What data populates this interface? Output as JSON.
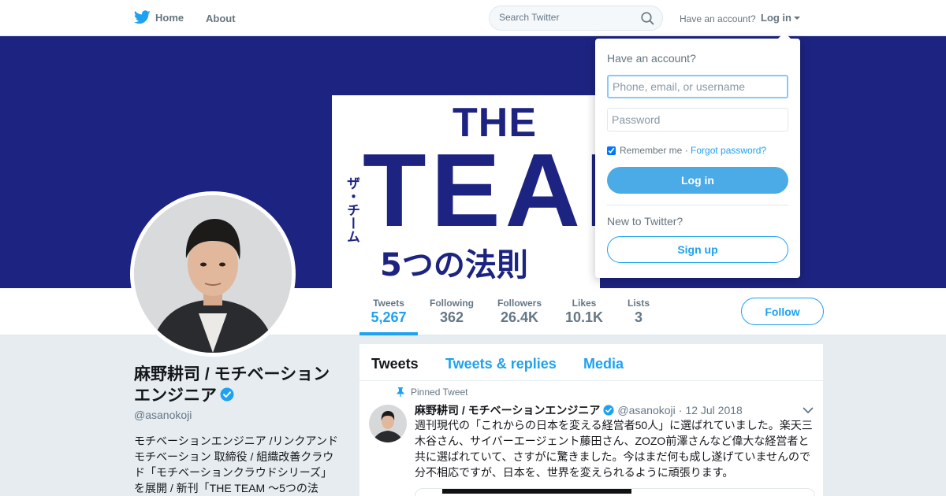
{
  "nav": {
    "home_label": "Home",
    "about_label": "About",
    "search_placeholder": "Search Twitter",
    "have_account": "Have an account?",
    "login_label": "Log in"
  },
  "banner": {
    "background_color": "#1d2381",
    "line_the": "THE",
    "line_team": "TEAM",
    "line_katakana": "ザ・チーム",
    "line_subtitle": "5つの法則"
  },
  "profile_stats": [
    {
      "label": "Tweets",
      "value": "5,267",
      "active": true
    },
    {
      "label": "Following",
      "value": "362"
    },
    {
      "label": "Followers",
      "value": "26.4K"
    },
    {
      "label": "Likes",
      "value": "10.1K"
    },
    {
      "label": "Lists",
      "value": "3"
    }
  ],
  "follow_label": "Follow",
  "profile": {
    "name_line1": "麻野耕司 / モチベーション",
    "name_line2": "エンジニア",
    "verified": true,
    "handle": "@asanokoji",
    "bio": "モチベーションエンジニア /リンクアンドモチベーション 取締役 / 組織改善クラウド「モチベーションクラウドシリーズ」を展開 / 新刊「THE TEAM 〜5つの法"
  },
  "timeline": {
    "tabs": [
      "Tweets",
      "Tweets & replies",
      "Media"
    ],
    "active_tab": "Tweets",
    "pinned_label": "Pinned Tweet",
    "tweet": {
      "name": "麻野耕司 / モチベーションエンジニア",
      "handle": "@asanokoji",
      "separator": "·",
      "date": "12 Jul 2018",
      "text": "週刊現代の「これからの日本を変える経営者50人」に選ばれていました。楽天三木谷さん、サイバーエージェント藤田さん、ZOZO前澤さんなど偉大な経営者と共に選ばれていて、さすがに驚きました。今はまだ何も成し遂げていませんので分不相応ですが、日本を、世界を変えられるように頑張ります。"
    }
  },
  "login_dropdown": {
    "title": "Have an account?",
    "username_placeholder": "Phone, email, or username",
    "password_placeholder": "Password",
    "remember_label": "Remember me",
    "remember_checked": true,
    "separator": " · ",
    "forgot_label": "Forgot password?",
    "login_button": "Log in",
    "new_label": "New to Twitter?",
    "signup_button": "Sign up"
  },
  "colors": {
    "accent": "#1da1f2",
    "login_button": "#4aabe7",
    "page_background": "#e6ecf0"
  }
}
